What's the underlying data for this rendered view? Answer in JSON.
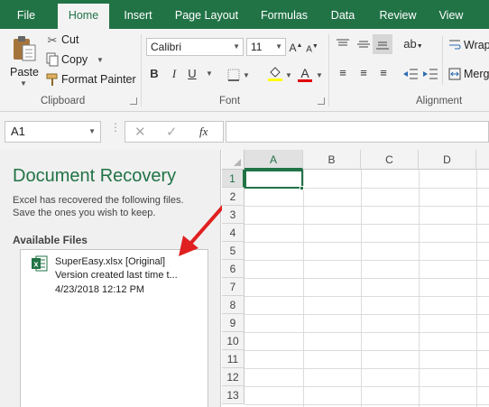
{
  "tabs": [
    {
      "label": "File",
      "active": false
    },
    {
      "label": "Home",
      "active": true
    },
    {
      "label": "Insert",
      "active": false
    },
    {
      "label": "Page Layout",
      "active": false
    },
    {
      "label": "Formulas",
      "active": false
    },
    {
      "label": "Data",
      "active": false
    },
    {
      "label": "Review",
      "active": false
    },
    {
      "label": "View",
      "active": false
    }
  ],
  "clipboard": {
    "paste": "Paste",
    "cut": "Cut",
    "copy": "Copy",
    "format_painter": "Format Painter",
    "group_label": "Clipboard"
  },
  "font": {
    "family": "Calibri",
    "size": "11",
    "bold": "B",
    "italic": "I",
    "underline": "U",
    "color_letter": "A",
    "group_label": "Font"
  },
  "alignment": {
    "wrap_text": "Wrap",
    "merge": "Merg",
    "group_label": "Alignment"
  },
  "formula_bar": {
    "name_box": "A1",
    "fx": "fx",
    "formula": ""
  },
  "recovery": {
    "title": "Document Recovery",
    "desc_line1": "Excel has recovered the following files.",
    "desc_line2": "Save the ones you wish to keep.",
    "available": "Available Files",
    "file": {
      "name": "SuperEasy.xlsx  [Original]",
      "version": "Version created last time t...",
      "timestamp": "4/23/2018 12:12 PM"
    }
  },
  "sheet": {
    "columns": [
      "A",
      "B",
      "C",
      "D"
    ],
    "rows": [
      "1",
      "2",
      "3",
      "4",
      "5",
      "6",
      "7",
      "8",
      "9",
      "10",
      "11",
      "12",
      "13"
    ],
    "selected_cell": "A1"
  },
  "colors": {
    "excel_green": "#217346",
    "annotation_arrow": "#e02020"
  }
}
